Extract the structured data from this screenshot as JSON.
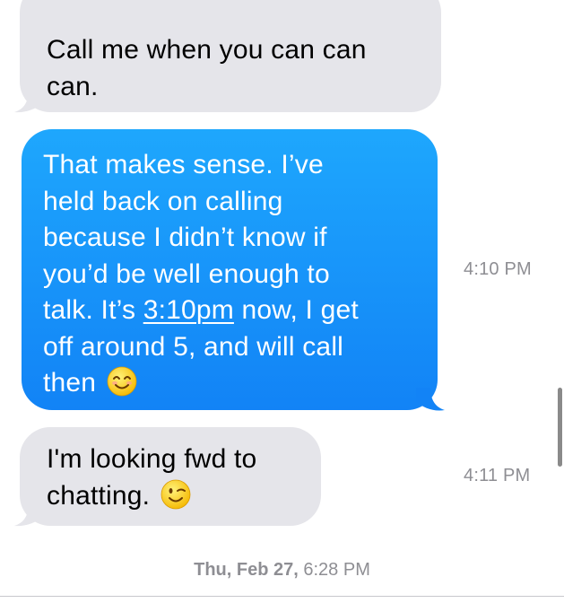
{
  "messages": [
    {
      "direction": "received",
      "text": "Call me when you can can\ncan."
    },
    {
      "direction": "sent",
      "text_before": "That makes sense.  I’ve\nheld back on calling\nbecause I didn’t know if\nyou’d be well enough to\ntalk.  It’s ",
      "link_text": "3:10pm",
      "text_after": " now, I get\noff around 5, and will call\nthen",
      "emoji": "smiling-face-emoji",
      "timestamp": "4:10 PM"
    },
    {
      "direction": "received",
      "text": "I'm looking fwd to\nchatting.",
      "emoji": "winking-face-emoji",
      "timestamp": "4:11 PM"
    }
  ],
  "date_header": {
    "day": "Thu, Feb 27,",
    "time": " 6:28 PM"
  },
  "colors": {
    "received_bubble": "#e5e5ea",
    "sent_bubble": "#1283f6",
    "timestamp": "#8e8e93"
  }
}
